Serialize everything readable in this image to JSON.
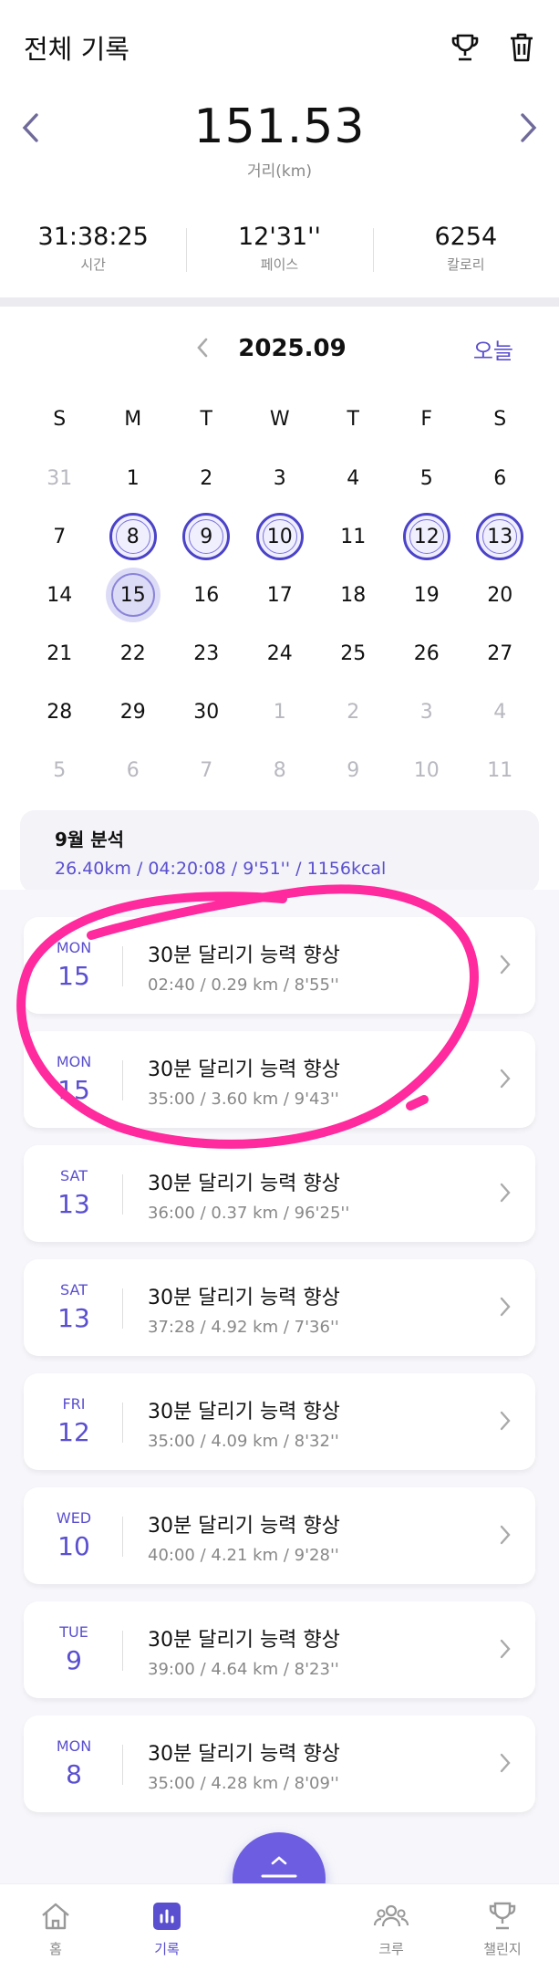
{
  "header": {
    "title": "전체 기록"
  },
  "summary": {
    "distance": "151.53",
    "distance_label": "거리(km)"
  },
  "stats": [
    {
      "value": "31:38:25",
      "label": "시간"
    },
    {
      "value": "12'31''",
      "label": "페이스"
    },
    {
      "value": "6254",
      "label": "칼로리"
    }
  ],
  "calendar": {
    "month": "2025.09",
    "today_label": "오늘",
    "weekdays": [
      "S",
      "M",
      "T",
      "W",
      "T",
      "F",
      "S"
    ],
    "days": [
      {
        "d": "31",
        "muted": true
      },
      {
        "d": "1"
      },
      {
        "d": "2"
      },
      {
        "d": "3"
      },
      {
        "d": "4"
      },
      {
        "d": "5"
      },
      {
        "d": "6"
      },
      {
        "d": "7"
      },
      {
        "d": "8",
        "stamp": true
      },
      {
        "d": "9",
        "stamp": true
      },
      {
        "d": "10",
        "stamp": true
      },
      {
        "d": "11"
      },
      {
        "d": "12",
        "stamp": true
      },
      {
        "d": "13",
        "stamp": true
      },
      {
        "d": "14"
      },
      {
        "d": "15",
        "today": true
      },
      {
        "d": "16"
      },
      {
        "d": "17"
      },
      {
        "d": "18"
      },
      {
        "d": "19"
      },
      {
        "d": "20"
      },
      {
        "d": "21"
      },
      {
        "d": "22"
      },
      {
        "d": "23"
      },
      {
        "d": "24"
      },
      {
        "d": "25"
      },
      {
        "d": "26"
      },
      {
        "d": "27"
      },
      {
        "d": "28"
      },
      {
        "d": "29"
      },
      {
        "d": "30"
      },
      {
        "d": "1",
        "muted": true
      },
      {
        "d": "2",
        "muted": true
      },
      {
        "d": "3",
        "muted": true
      },
      {
        "d": "4",
        "muted": true
      },
      {
        "d": "5",
        "muted": true
      },
      {
        "d": "6",
        "muted": true
      },
      {
        "d": "7",
        "muted": true
      },
      {
        "d": "8",
        "muted": true
      },
      {
        "d": "9",
        "muted": true
      },
      {
        "d": "10",
        "muted": true
      },
      {
        "d": "11",
        "muted": true
      }
    ]
  },
  "analysis": {
    "title": "9월 분석",
    "text": "26.40km / 04:20:08 / 9'51'' / 1156kcal"
  },
  "records": [
    {
      "dow": "MON",
      "date": "15",
      "title": "30분 달리기 능력 향상",
      "meta": "02:40 / 0.29 km / 8'55''"
    },
    {
      "dow": "MON",
      "date": "15",
      "title": "30분 달리기 능력 향상",
      "meta": "35:00 / 3.60 km / 9'43''"
    },
    {
      "dow": "SAT",
      "date": "13",
      "title": "30분 달리기 능력 향상",
      "meta": "36:00 / 0.37 km / 96'25''"
    },
    {
      "dow": "SAT",
      "date": "13",
      "title": "30분 달리기 능력 향상",
      "meta": "37:28 / 4.92 km / 7'36''"
    },
    {
      "dow": "FRI",
      "date": "12",
      "title": "30분 달리기 능력 향상",
      "meta": "35:00 / 4.09 km / 8'32''"
    },
    {
      "dow": "WED",
      "date": "10",
      "title": "30분 달리기 능력 향상",
      "meta": "40:00 / 4.21 km / 9'28''"
    },
    {
      "dow": "TUE",
      "date": "9",
      "title": "30분 달리기 능력 향상",
      "meta": "39:00 / 4.64 km / 8'23''"
    },
    {
      "dow": "MON",
      "date": "8",
      "title": "30분 달리기 능력 향상",
      "meta": "35:00 / 4.28 km / 8'09''"
    }
  ],
  "nav": {
    "home": "홈",
    "records": "기록",
    "crew": "크루",
    "challenge": "챌린지"
  },
  "colors": {
    "accent": "#5a4fcf",
    "highlight": "#ff2a9d"
  }
}
